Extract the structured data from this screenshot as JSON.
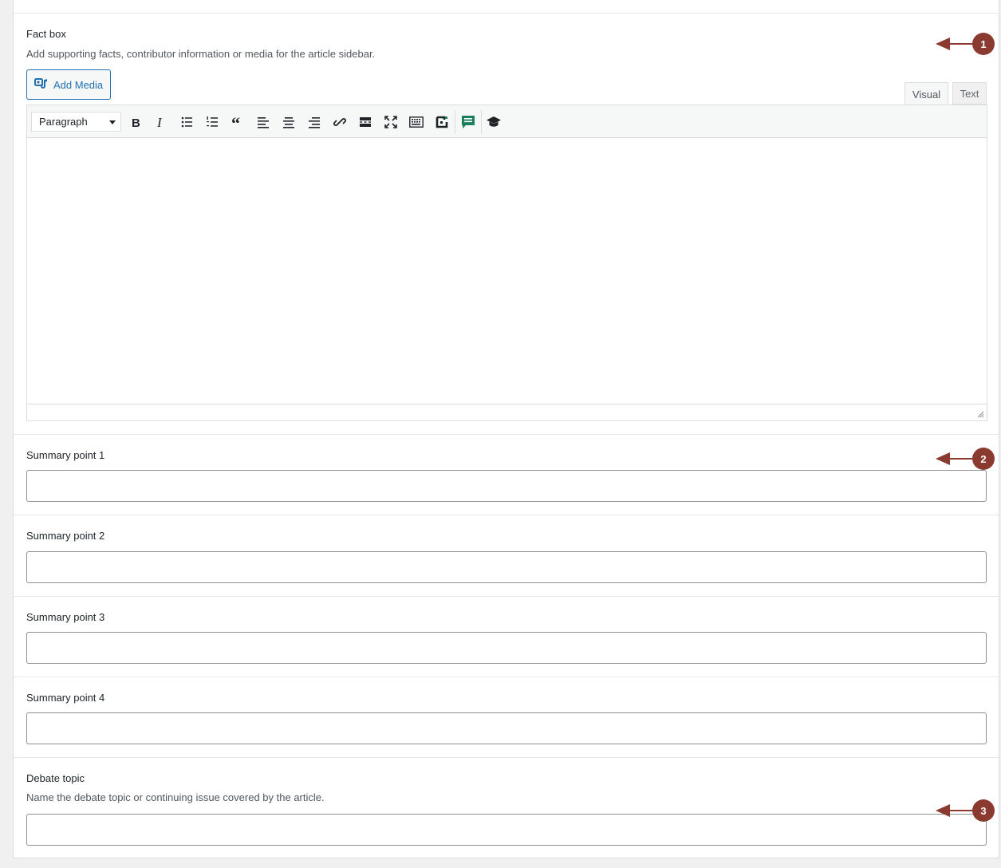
{
  "fact_box": {
    "label": "Fact box",
    "description": "Add supporting facts, contributor information or media for the article sidebar.",
    "add_media_label": "Add Media",
    "tab_visual": "Visual",
    "tab_text": "Text",
    "format_select": "Paragraph",
    "content": ""
  },
  "toolbar_icons": [
    "bold-icon",
    "italic-icon",
    "bullet-list-icon",
    "numbered-list-icon",
    "blockquote-icon",
    "align-left-icon",
    "align-center-icon",
    "align-right-icon",
    "link-icon",
    "read-more-icon",
    "fullscreen-icon",
    "toolbar-toggle-icon",
    "embed-icon",
    "comment-icon",
    "graduation-cap-icon"
  ],
  "fields": [
    {
      "label": "Summary point 1",
      "value": ""
    },
    {
      "label": "Summary point 2",
      "value": ""
    },
    {
      "label": "Summary point 3",
      "value": ""
    },
    {
      "label": "Summary point 4",
      "value": ""
    }
  ],
  "debate_topic": {
    "label": "Debate topic",
    "description": "Name the debate topic or continuing issue covered by the article.",
    "value": ""
  },
  "callouts": [
    "1",
    "2",
    "3"
  ],
  "colors": {
    "accent": "#2271b1",
    "callout": "#8b3a2f",
    "comment_icon": "#1a7f5a"
  }
}
